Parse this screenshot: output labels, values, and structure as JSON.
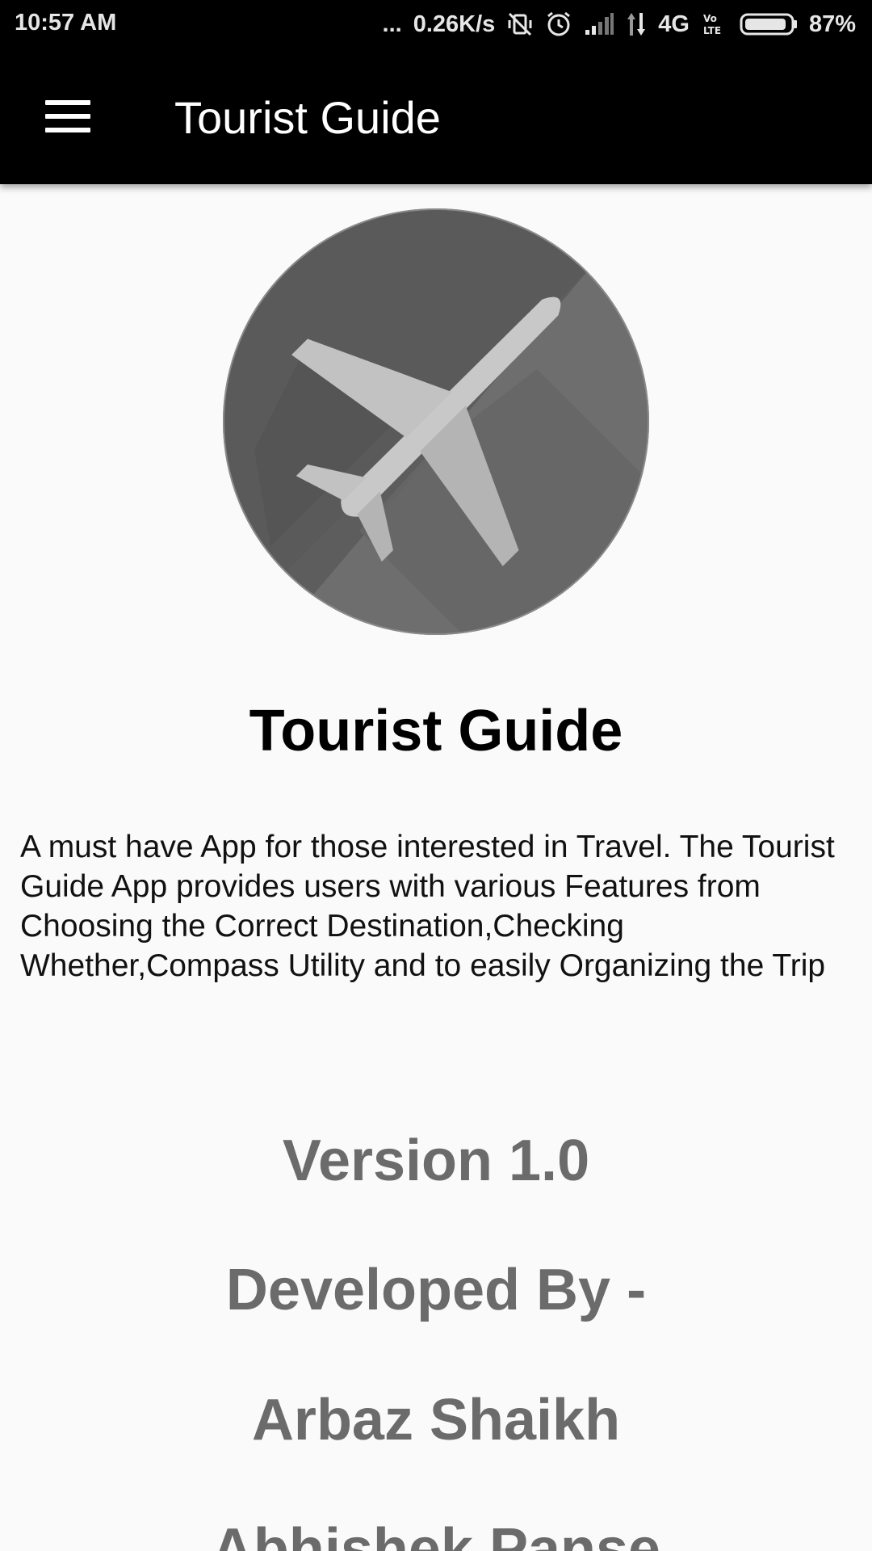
{
  "status_bar": {
    "time": "10:57 AM",
    "dots": "...",
    "net_speed": "0.26K/s",
    "network_type": "4G",
    "volte": "Vo LTE",
    "battery": "87%",
    "icons": [
      "vibrate-off-icon",
      "alarm-icon",
      "signal-icon",
      "data-arrows-icon",
      "battery-icon"
    ]
  },
  "app_bar": {
    "title": "Tourist Guide",
    "menu_icon": "hamburger-menu-icon"
  },
  "content": {
    "logo_icon": "airplane-icon",
    "heading": "Tourist Guide",
    "description": "A must have App for those interested in Travel. The Tourist Guide App provides users with various Features from Choosing the Correct Destination,Checking Whether,Compass Utility and to easily Organizing the Trip",
    "version": "Version 1.0",
    "developed_by": "Developed By -",
    "developers": [
      "Arbaz Shaikh",
      "Abhishek Panse"
    ]
  },
  "colors": {
    "app_bar": "#000000",
    "background": "#fafafa",
    "info_text": "#6b6b6b",
    "logo_circle": "#616161",
    "plane": "#c8c8c8"
  }
}
